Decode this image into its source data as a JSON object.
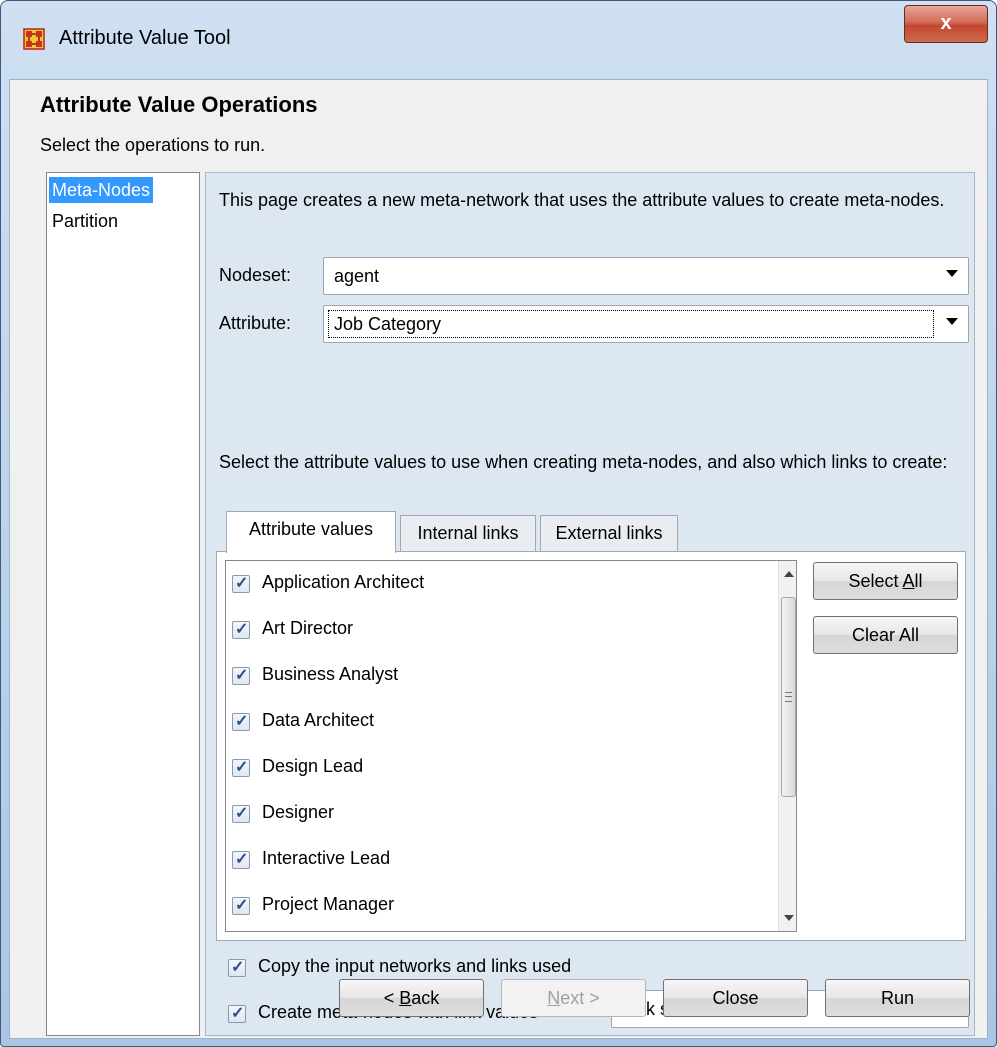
{
  "window": {
    "title": "Attribute Value Tool",
    "close_glyph": "x"
  },
  "header": {
    "title": "Attribute Value Operations",
    "subtitle": "Select the operations to run."
  },
  "operations": [
    {
      "label": "Meta-Nodes",
      "selected": true
    },
    {
      "label": "Partition",
      "selected": false
    }
  ],
  "panel": {
    "description": "This page creates a new meta-network that uses the attribute values to create meta-nodes.",
    "nodeset": {
      "label": "Nodeset:",
      "value": "agent"
    },
    "attribute": {
      "label": "Attribute:",
      "value": "Job Category"
    },
    "prompt": "Select the attribute values to use when creating meta-nodes, and also which links to create:",
    "tabs": [
      {
        "label": "Attribute values",
        "active": true
      },
      {
        "label": "Internal links",
        "active": false
      },
      {
        "label": "External links",
        "active": false
      }
    ],
    "values": [
      {
        "label": "Application Architect",
        "checked": true
      },
      {
        "label": "Art Director",
        "checked": true
      },
      {
        "label": "Business Analyst",
        "checked": true
      },
      {
        "label": "Data Architect",
        "checked": true
      },
      {
        "label": "Design Lead",
        "checked": true
      },
      {
        "label": "Designer",
        "checked": true
      },
      {
        "label": "Interactive Lead",
        "checked": true
      },
      {
        "label": "Project Manager",
        "checked": true
      }
    ],
    "select_all": {
      "pre": "Select ",
      "key": "A",
      "post": "ll"
    },
    "clear_all": "Clear All",
    "copy_option": {
      "label": "Copy the input networks and links used",
      "checked": true
    },
    "link_option": {
      "label": "Create meta-nodes with link values",
      "checked": true,
      "value": "Link sum"
    }
  },
  "footer": {
    "back": {
      "pre": "< ",
      "key": "B",
      "post": "ack"
    },
    "next": {
      "pre": "",
      "key": "N",
      "post": "ext >",
      "enabled": false
    },
    "close": "Close",
    "run": "Run"
  },
  "colors": {
    "selection": "#3399ff",
    "panel": "#dde7f2",
    "close_button": "#c2472e"
  }
}
